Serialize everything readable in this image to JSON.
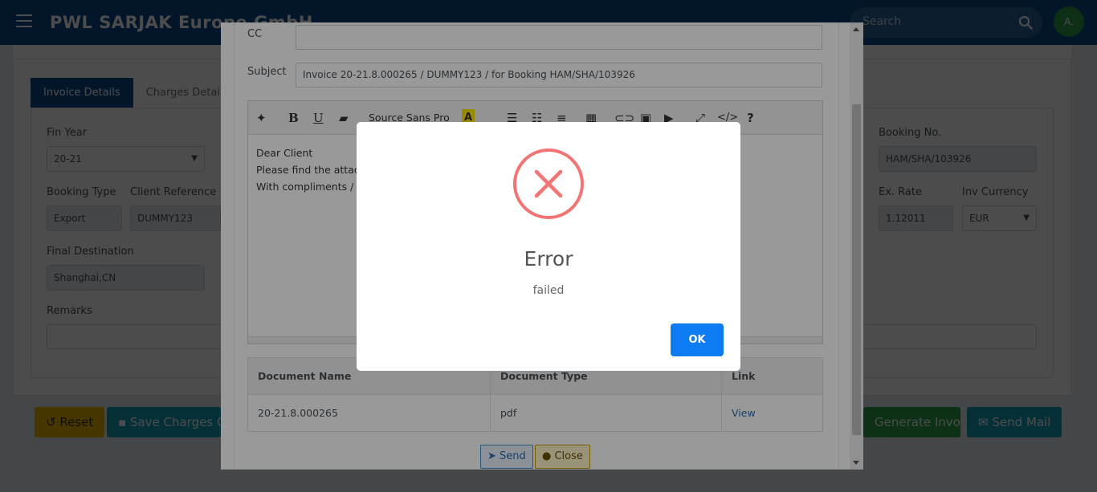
{
  "app": {
    "brand": "PWL SARJAK Europe GmbH",
    "search_placeholder": "Search",
    "avatar_initial": "A."
  },
  "tabs": [
    "Invoice Details",
    "Charges Details"
  ],
  "form": {
    "fin_year_label": "Fin Year",
    "fin_year_value": "20-21",
    "booking_no_label": "Booking No.",
    "booking_no_value": "HAM/SHA/103926",
    "booking_type_label": "Booking Type",
    "booking_type_value": "Export",
    "client_ref_label": "Client Reference",
    "client_ref_value": "DUMMY123",
    "ex_rate_label": "Ex. Rate",
    "ex_rate_value": "1.12011",
    "inv_currency_label": "Inv Currency",
    "inv_currency_value": "EUR",
    "final_dest_label": "Final Destination",
    "final_dest_value": "Shanghai,CN",
    "remarks_label": "Remarks"
  },
  "footer_buttons": {
    "reset": "Reset",
    "save_charges": "Save Charges On",
    "generate_invoice": "Generate Invoice",
    "send_mail": "Send Mail"
  },
  "email": {
    "cc_label": "CC",
    "cc_value": "",
    "subject_label": "Subject",
    "subject_value": "Invoice 20-21.8.000265 / DUMMY123 / for Booking HAM/SHA/103926",
    "font_name": "Source Sans Pro",
    "body_lines": [
      "Dear Client",
      "Please find the attach",
      "With compliments / M"
    ],
    "table_headers": [
      "Document Name",
      "Document Type",
      "Link"
    ],
    "rows": [
      {
        "name": "20-21.8.000265",
        "type": "pdf",
        "link": "View"
      }
    ],
    "send_label": "Send",
    "close_label": "Close"
  },
  "dialog": {
    "title": "Error",
    "message": "failed",
    "ok_label": "OK",
    "icon_color": "#f27474",
    "button_color": "#0d7cf2"
  }
}
